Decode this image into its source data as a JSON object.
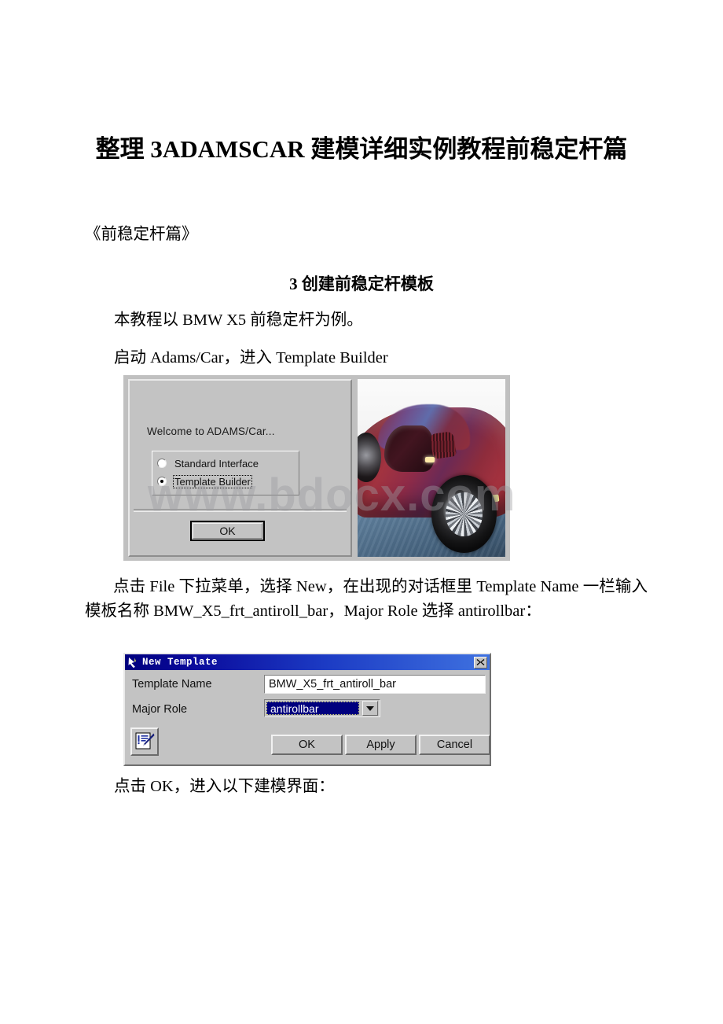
{
  "document": {
    "title": "整理 3ADAMSCAR 建模详细实例教程前稳定杆篇",
    "book_title": "《前稳定杆篇》",
    "section_heading": "3 创建前稳定杆模板",
    "paragraphs": {
      "intro_1": "本教程以 BMW X5 前稳定杆为例。",
      "intro_2": "启动 Adams/Car，进入 Template Builder",
      "instruction_block": "点击 File 下拉菜单，选择 New，在出现的对话框里 Template Name 一栏输入模板名称 BMW_X5_frt_antiroll_bar，Major Role 选择 antirollbar：",
      "final": "点击 OK，进入以下建模界面："
    },
    "watermark": "www.bdocx.com"
  },
  "welcome_dialog": {
    "message": "Welcome to ADAMS/Car...",
    "options": [
      {
        "label": "Standard Interface",
        "selected": false,
        "focused": false
      },
      {
        "label": "Template Builder",
        "selected": true,
        "focused": true
      }
    ],
    "ok_label": "OK",
    "photo_alt": "red-sports-car-photo"
  },
  "new_template_dialog": {
    "title": "New Template",
    "title_icon": "adams-arrow-icon",
    "close_icon": "close-icon",
    "fields": [
      {
        "label": "Template Name",
        "value": "BMW_X5_frt_antiroll_bar"
      },
      {
        "label": "Major Role",
        "value": "antirollbar"
      }
    ],
    "note_button_icon": "edit-note-pen-icon",
    "buttons": {
      "ok": "OK",
      "apply": "Apply",
      "cancel": "Cancel"
    }
  },
  "colors": {
    "titlebar_blue": "#00007e",
    "dialog_face": "#c3c3c3",
    "select_navy": "#00007e",
    "watermark_gray": "#9b9ba0"
  }
}
